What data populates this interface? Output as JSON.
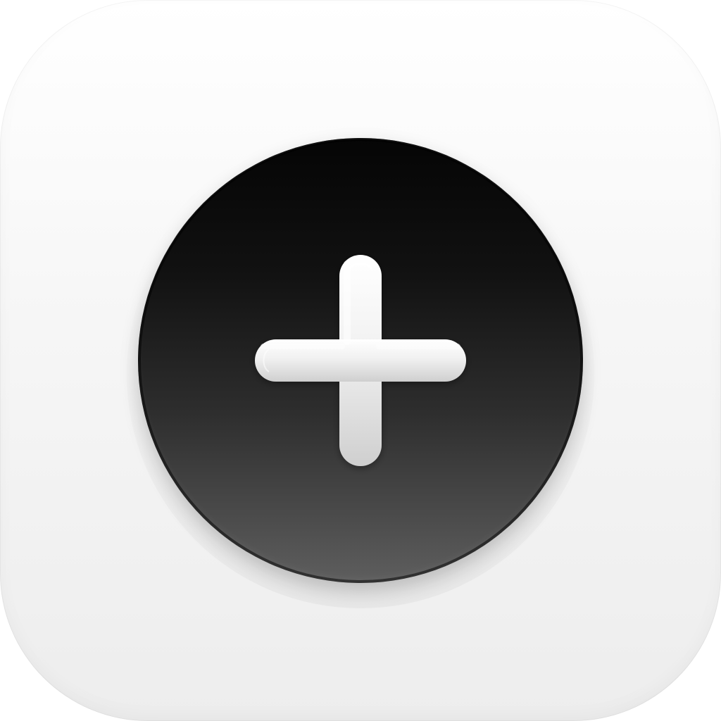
{
  "app_icon": {
    "semantic": "add-app-icon",
    "background_color": "#f4f4f4",
    "button_color": "#1a1a1a",
    "glyph": {
      "icon": "plus-icon",
      "color": "#f2f2f2"
    }
  }
}
